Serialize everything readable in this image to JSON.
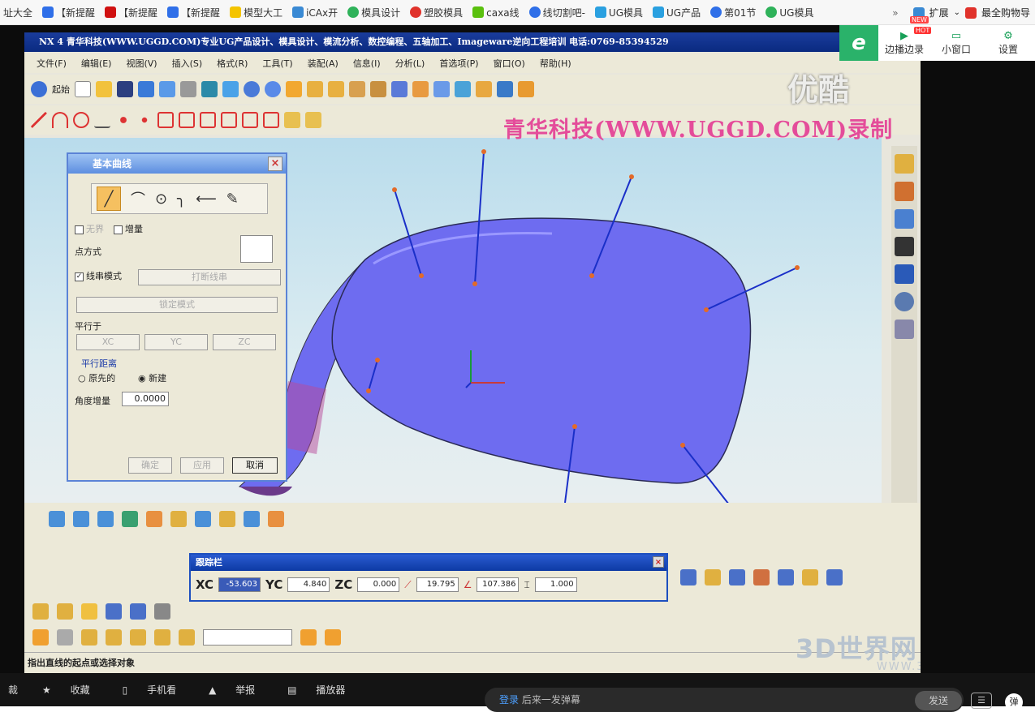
{
  "bookmarks": [
    {
      "label": "址大全",
      "icon": "none"
    },
    {
      "label": "【新提醒",
      "icon": "ie-icon"
    },
    {
      "label": "【新提醒",
      "icon": "m-icon"
    },
    {
      "label": "【新提醒",
      "icon": "ie-icon"
    },
    {
      "label": "模型大工",
      "icon": "model-icon"
    },
    {
      "label": "iCAx开",
      "icon": "leaf-icon"
    },
    {
      "label": "模具设计",
      "icon": "play-icon"
    },
    {
      "label": "塑胶模具",
      "icon": "play-icon"
    },
    {
      "label": "caxa线",
      "icon": "nc-icon"
    },
    {
      "label": "线切割吧-",
      "icon": "paw-icon"
    },
    {
      "label": "UG模具",
      "icon": "cube-icon"
    },
    {
      "label": "UG产品",
      "icon": "cube-icon"
    },
    {
      "label": "第01节",
      "icon": "paw-icon"
    },
    {
      "label": "UG模具",
      "icon": "play-icon"
    }
  ],
  "more_label": "»",
  "extend_label": "扩展",
  "extend_badge": "NEW",
  "shopping_label": "最全购物导",
  "side_panel": {
    "pip_label": "边播边录",
    "pip_badge": "HOT",
    "mini_label": "小窗口",
    "settings_label": "设置"
  },
  "ug": {
    "title": "NX 4 青华科技(WWW.UGGD.COM)专业UG产品设计、模具设计、模流分析、数控编程、五轴加工、Imageware逆向工程培训 电话:0769-85394529",
    "menus": [
      "文件(F)",
      "编辑(E)",
      "视图(V)",
      "插入(S)",
      "格式(R)",
      "工具(T)",
      "装配(A)",
      "信息(I)",
      "分析(L)",
      "首选项(P)",
      "窗口(O)",
      "帮助(H)"
    ],
    "start_label": "起始",
    "watermark": "青华科技(WWW.UGGD.COM)录制",
    "youku": "优酷",
    "status": "指出直线的起点或选择对象"
  },
  "dialog": {
    "title": "基本曲线",
    "close": "×",
    "unbounded_label": "无界",
    "increment_label": "增量",
    "point_method_label": "点方式",
    "string_mode_label": "线串模式",
    "break_string_button": "打断线串",
    "lock_mode_button": "锁定模式",
    "parallel_to_label": "平行于",
    "xc": "XC",
    "yc": "YC",
    "zc": "ZC",
    "parallel_distance_label": "平行距离",
    "original_label": "原先的",
    "new_label": "新建",
    "angle_increment_label": "角度增量",
    "angle_increment_value": "0.0000",
    "ok": "确定",
    "apply": "应用",
    "cancel": "取消"
  },
  "tracker": {
    "title": "跟踪栏",
    "close": "×",
    "xc_label": "XC",
    "xc_value": "-53.603",
    "yc_label": "YC",
    "yc_value": "4.840",
    "zc_label": "ZC",
    "zc_value": "0.000",
    "length_value": "19.795",
    "angle_value": "107.386",
    "offset_value": "1.000"
  },
  "logo": {
    "main": "3D世界网",
    "sub": "WWW.3DSJW.COM"
  },
  "bottom": {
    "items": [
      "裁",
      "收藏",
      "手机看",
      "举报",
      "播放器"
    ],
    "danmu_login": "登录",
    "danmu_text": "后来一发弹幕",
    "send": "发送",
    "danmu_toggle": "弹"
  },
  "colors": {
    "ug_title_bg": "#0a2a80",
    "model_surface": "#6e6cf0",
    "watermark": "#e44c9a",
    "viewport_top": "#b9dcec"
  }
}
